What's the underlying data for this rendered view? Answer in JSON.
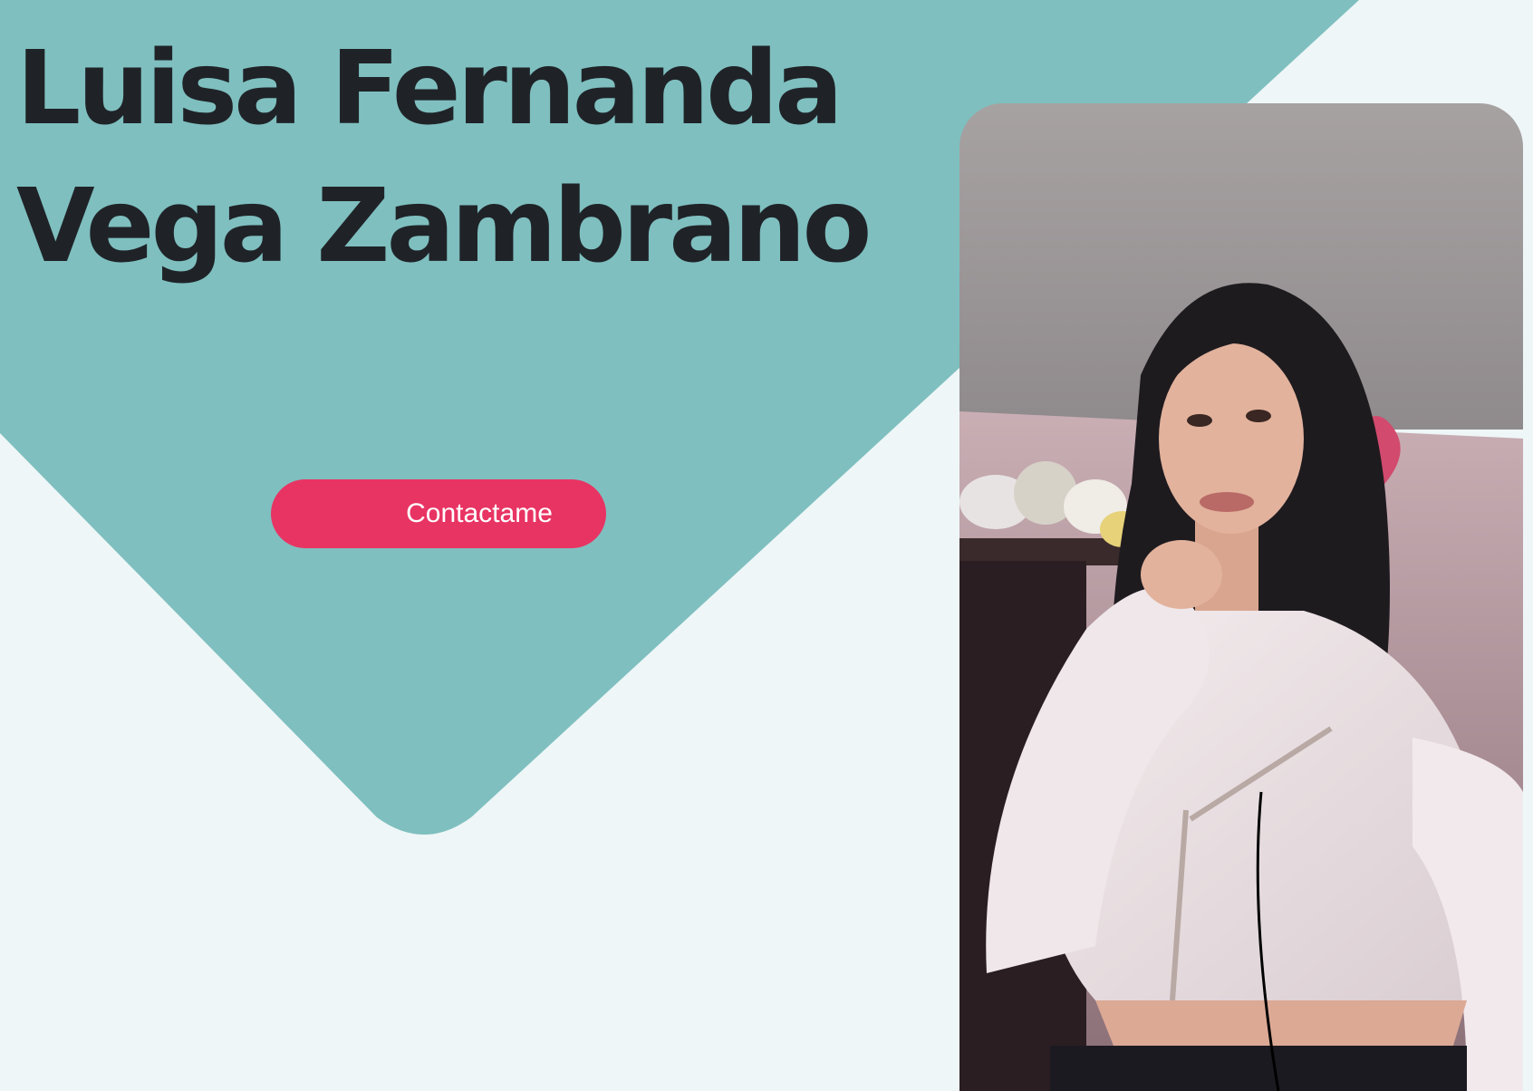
{
  "hero": {
    "name_line1": "Luisa Fernanda",
    "name_line2": "Vega Zambrano"
  },
  "cta": {
    "label": "Contactame"
  },
  "photo": {
    "alt": "Luisa Fernanda Vega Zambrano"
  },
  "colors": {
    "background": "#eef6f7",
    "teal_shape": "#7fbfbf",
    "heading": "#1f2328",
    "button": "#e83463",
    "button_text": "#ffffff"
  }
}
